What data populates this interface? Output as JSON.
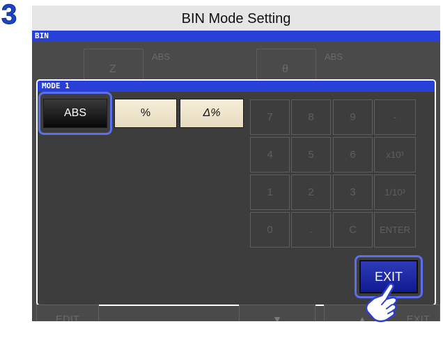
{
  "step_number": "3",
  "caption": "BIN Mode Setting",
  "screen": {
    "title": "BIN",
    "param1": {
      "name": "Z",
      "tag": "ABS"
    },
    "param2": {
      "name": "θ",
      "tag": "ABS"
    }
  },
  "panel": {
    "title": "MODE 1",
    "modes": [
      {
        "label": "ABS",
        "selected": true
      },
      {
        "label": "%",
        "selected": false
      },
      {
        "label": "Δ%",
        "selected": false
      }
    ],
    "keypad": [
      "7",
      "8",
      "9",
      "-",
      "4",
      "5",
      "6",
      "x10³",
      "1",
      "2",
      "3",
      "1/10³",
      "0",
      ".",
      "C",
      "ENTER"
    ],
    "exit_label": "EXIT"
  },
  "bottom": {
    "edit_label": "EDIT",
    "down_icon": "▼",
    "up_icon": "▲",
    "exit_label": "EXIT"
  },
  "colors": {
    "accent": "#2840d8",
    "highlight": "#5b6ef0",
    "step": "#1a45c8"
  }
}
